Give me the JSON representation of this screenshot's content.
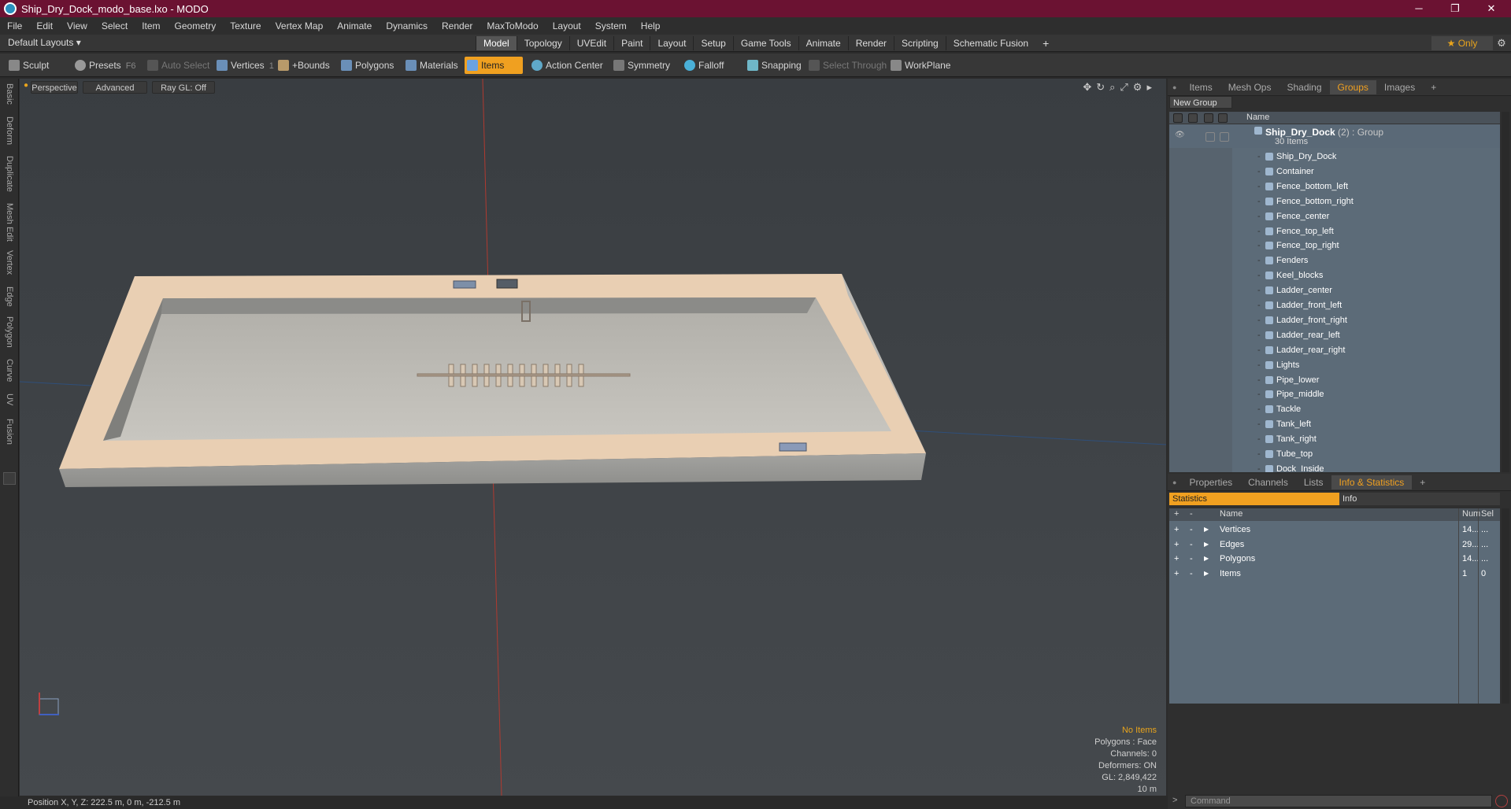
{
  "window": {
    "title": "Ship_Dry_Dock_modo_base.lxo - MODO",
    "minimize": "─",
    "maximize": "❐",
    "close": "✕"
  },
  "menu": [
    "File",
    "Edit",
    "View",
    "Select",
    "Item",
    "Geometry",
    "Texture",
    "Vertex Map",
    "Animate",
    "Dynamics",
    "Render",
    "MaxToModo",
    "Layout",
    "System",
    "Help"
  ],
  "layout": {
    "default_layouts": "Default Layouts ▾",
    "tabs": [
      "Model",
      "Topology",
      "UVEdit",
      "Paint",
      "Layout",
      "Setup",
      "Game Tools",
      "Animate",
      "Render",
      "Scripting",
      "Schematic Fusion"
    ],
    "active_tab": "Model",
    "add": "+",
    "only": "★ Only"
  },
  "toolbar": {
    "sculpt": "Sculpt",
    "presets": "Presets",
    "presets_key": "F6",
    "auto_select": "Auto Select",
    "vertices": "Vertices",
    "vertices_key": "1",
    "bounds": "+Bounds",
    "polygons": "Polygons",
    "materials": "Materials",
    "items": "Items",
    "action_center": "Action Center",
    "symmetry": "Symmetry",
    "falloff": "Falloff",
    "snapping": "Snapping",
    "select_through": "Select Through",
    "workplane": "WorkPlane"
  },
  "left_tabs": [
    "Basic",
    "Deform",
    "Duplicate",
    "Mesh Edit",
    "Vertex",
    "Edge",
    "Polygon",
    "Curve",
    "UV",
    "Fusion"
  ],
  "viewport": {
    "perspective": "Perspective",
    "advanced": "Advanced",
    "raygl": "Ray GL: Off",
    "stats": {
      "no_items": "No Items",
      "polygons": "Polygons : Face",
      "channels": "Channels: 0",
      "deformers": "Deformers: ON",
      "gl": "GL: 2,849,422",
      "scale": "10 m"
    }
  },
  "status": {
    "position": "Position X, Y, Z:   222.5 m, 0 m, -212.5 m"
  },
  "groups_panel": {
    "tabs": [
      "Items",
      "Mesh Ops",
      "Shading",
      "Groups",
      "Images"
    ],
    "active": "Groups",
    "new_group": "New Group",
    "col_name": "Name",
    "group_name": "Ship_Dry_Dock",
    "group_count": " (2)",
    "group_type": " : Group",
    "group_items": "30 Items",
    "items": [
      "Ship_Dry_Dock",
      "Container",
      "Fence_bottom_left",
      "Fence_bottom_right",
      "Fence_center",
      "Fence_top_left",
      "Fence_top_right",
      "Fenders",
      "Keel_blocks",
      "Ladder_center",
      "Ladder_front_left",
      "Ladder_front_right",
      "Ladder_rear_left",
      "Ladder_rear_right",
      "Lights",
      "Pipe_lower",
      "Pipe_middle",
      "Tackle",
      "Tank_left",
      "Tank_right",
      "Tube_top",
      "Dock_Inside"
    ]
  },
  "info_panel": {
    "tabs": [
      "Properties",
      "Channels",
      "Lists",
      "Info & Statistics"
    ],
    "active": "Info & Statistics",
    "sub_statistics": "Statistics",
    "sub_info": "Info",
    "col_name": "Name",
    "col_num": "Num",
    "col_sel": "Sel",
    "rows": [
      {
        "name": "Vertices",
        "num": "14...",
        "sel": "..."
      },
      {
        "name": "Edges",
        "num": "29...",
        "sel": "..."
      },
      {
        "name": "Polygons",
        "num": "14...",
        "sel": "..."
      },
      {
        "name": "Items",
        "num": "1",
        "sel": "0"
      }
    ]
  },
  "command": {
    "placeholder": "Command"
  }
}
